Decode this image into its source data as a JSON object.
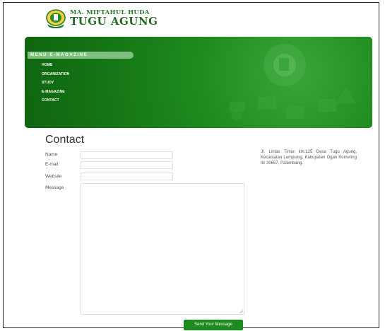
{
  "header": {
    "logo_line1": "MA. MIFTAHUL HUDA",
    "logo_line2": "TUGU AGUNG",
    "logo_icon": "school-emblem-icon",
    "accent_color": "#1d8a1d"
  },
  "menu": {
    "title": "MENU E-MAGAZINE",
    "items": [
      {
        "label": "HOME"
      },
      {
        "label": "ORGANIZATION"
      },
      {
        "label": "STUDY"
      },
      {
        "label": "E-MAGAZINE"
      },
      {
        "label": "CONTACT"
      }
    ]
  },
  "contact": {
    "title": "Contact",
    "name_label": "Name",
    "email_label": "E-mail",
    "website_label": "Website",
    "message_label": "Message",
    "name_value": "",
    "email_value": "",
    "website_value": "",
    "message_value": "",
    "send_label": "Send Your Message"
  },
  "address": {
    "text": "Jl. Lintas Timur km.125 Desa Tugu Agung, Kecamatan Lempuing, Kabupaten Ogan Komering Ilir 30657, Palembang."
  }
}
